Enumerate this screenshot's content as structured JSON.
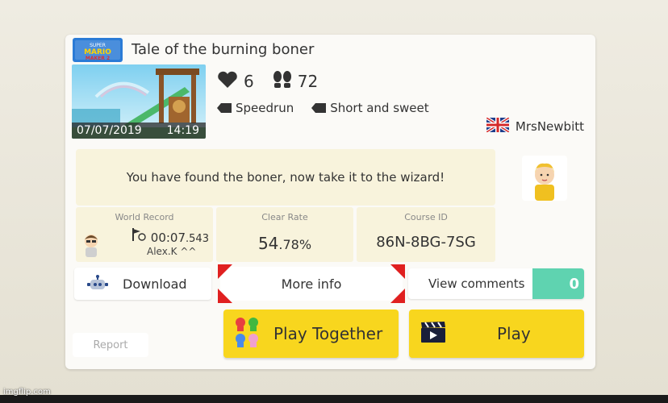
{
  "course": {
    "title": "Tale of the burning boner",
    "game_logo_text": "SUPER MARIO MAKER 2",
    "upload_date": "07/07/2019",
    "upload_time": "14:19",
    "likes": "6",
    "plays": "72",
    "tags": [
      "Speedrun",
      "Short and sweet"
    ],
    "maker_name": "MrsNewbitt",
    "maker_country": "UK",
    "description": "You have found the boner, now take it to the wizard!"
  },
  "stats": {
    "world_record_label": "World Record",
    "world_record_time_main": "00:07",
    "world_record_time_ms": ".543",
    "world_record_holder": "Alex.K ^^",
    "clear_rate_label": "Clear Rate",
    "clear_rate_main": "54",
    "clear_rate_decimal": ".78%",
    "course_id_label": "Course ID",
    "course_id": "86N-8BG-7SG"
  },
  "actions": {
    "download": "Download",
    "more_info": "More info",
    "view_comments": "View comments",
    "comments_count": "0",
    "report": "Report",
    "play_together": "Play Together",
    "play": "Play"
  },
  "watermark": "imgflip.com",
  "colors": {
    "accent_yellow": "#f8d61e",
    "comments_teal": "#5fd3b0",
    "info_box": "#f8f3dc",
    "selection_red": "#e02020"
  }
}
